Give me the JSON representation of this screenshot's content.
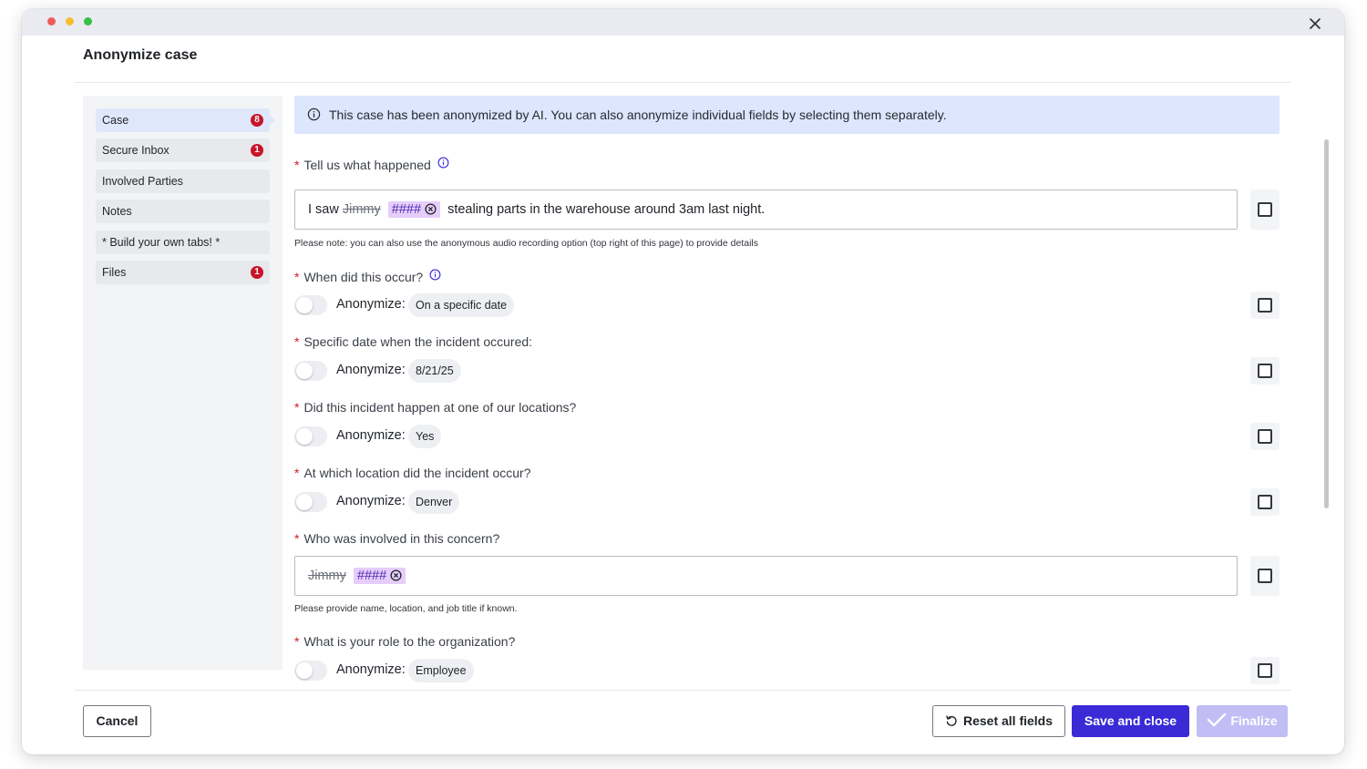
{
  "dialog": {
    "title": "Anonymize case",
    "close_icon": "close-icon"
  },
  "sidebar": {
    "items": [
      {
        "label": "Case",
        "badge": "8",
        "active": true
      },
      {
        "label": "Secure Inbox",
        "badge": "1"
      },
      {
        "label": "Involved Parties",
        "badge": ""
      },
      {
        "label": "Notes",
        "badge": ""
      },
      {
        "label": "* Build your own tabs! *",
        "badge": ""
      },
      {
        "label": "Files",
        "badge": "1"
      }
    ]
  },
  "banner": {
    "icon": "info-icon",
    "text": "This case has been anonymized by AI. You can also anonymize individual fields by selecting them separately."
  },
  "fields": {
    "what_happened": {
      "label": "Tell us what happened",
      "text_before": "I saw",
      "original_word": "Jimmy",
      "mask": "####",
      "text_after": "stealing parts in the warehouse around 3am last night.",
      "hint": "Please note: you can also use the anonymous audio recording option (top right of this page) to provide details"
    },
    "when_occur": {
      "label": "When did this occur?",
      "anonymize_label": "Anonymize:",
      "value": "On a specific date"
    },
    "specific_date": {
      "label": "Specific date when the incident occured:",
      "anonymize_label": "Anonymize:",
      "value": "8/21/25"
    },
    "at_location": {
      "label": "Did this incident happen at one of our locations?",
      "anonymize_label": "Anonymize:",
      "value": "Yes"
    },
    "which_location": {
      "label": "At which location did the incident occur?",
      "anonymize_label": "Anonymize:",
      "value": "Denver"
    },
    "who_involved": {
      "label": "Who was involved in this concern?",
      "original_word": "Jimmy",
      "mask": "####",
      "hint": "Please provide name, location, and job title if known."
    },
    "role": {
      "label": "What is your role to the organization?",
      "anonymize_label": "Anonymize:",
      "value": "Employee"
    }
  },
  "footer": {
    "cancel": "Cancel",
    "reset": "Reset all fields",
    "save": "Save and close",
    "finalize": "Finalize"
  },
  "colors": {
    "primary": "#3a2bd6",
    "primary_disabled": "#c2bdf4",
    "badge": "#c81428",
    "banner_bg": "#dce6fc",
    "mask_bg": "#e6cdfa",
    "required": "#d4182c"
  }
}
